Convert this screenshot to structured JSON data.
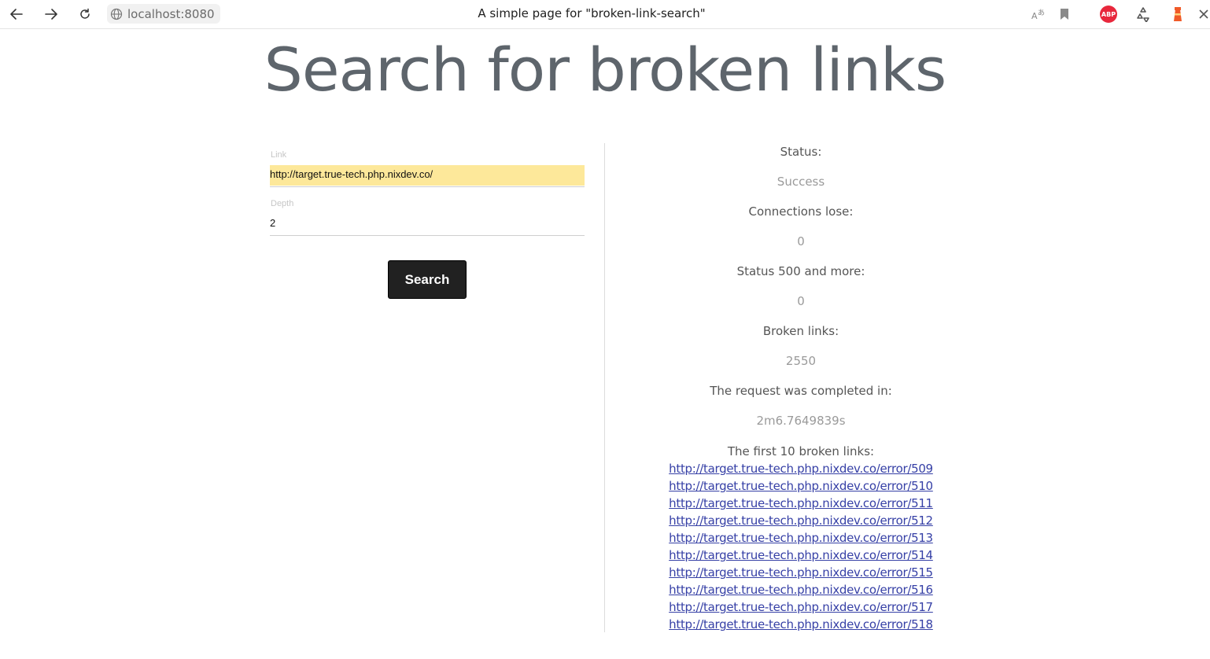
{
  "browser": {
    "url": "localhost:8080",
    "tab_title": "A simple page for \"broken-link-search\"",
    "toolbar_icons": [
      "back-arrow-icon",
      "forward-arrow-icon",
      "reload-icon",
      "globe-icon",
      "translate-icon",
      "bookmark-icon",
      "adblock-plus-icon",
      "recycle-icon",
      "lighthouse-icon",
      "puzzle-icon"
    ],
    "abp_label": "ABP"
  },
  "page": {
    "heading": "Search for broken links"
  },
  "form": {
    "link_label": "Link",
    "link_value": "http://target.true-tech.php.nixdev.co/",
    "depth_label": "Depth",
    "depth_value": "2",
    "search_label": "Search"
  },
  "results": {
    "status_label": "Status:",
    "status_value": "Success",
    "connections_lose_label": "Connections lose:",
    "connections_lose_value": "0",
    "status500_label": "Status 500 and more:",
    "status500_value": "0",
    "broken_links_label": "Broken links:",
    "broken_links_value": "2550",
    "completed_label": "The request was completed in:",
    "completed_value": "2m6.7649839s",
    "first10_label": "The first 10 broken links:",
    "links": [
      "http://target.true-tech.php.nixdev.co/error/509",
      "http://target.true-tech.php.nixdev.co/error/510",
      "http://target.true-tech.php.nixdev.co/error/511",
      "http://target.true-tech.php.nixdev.co/error/512",
      "http://target.true-tech.php.nixdev.co/error/513",
      "http://target.true-tech.php.nixdev.co/error/514",
      "http://target.true-tech.php.nixdev.co/error/515",
      "http://target.true-tech.php.nixdev.co/error/516",
      "http://target.true-tech.php.nixdev.co/error/517",
      "http://target.true-tech.php.nixdev.co/error/518"
    ]
  },
  "colors": {
    "autofill": "#fde89a",
    "button": "#212121",
    "link": "#3640a6",
    "heading": "#5e656c"
  }
}
